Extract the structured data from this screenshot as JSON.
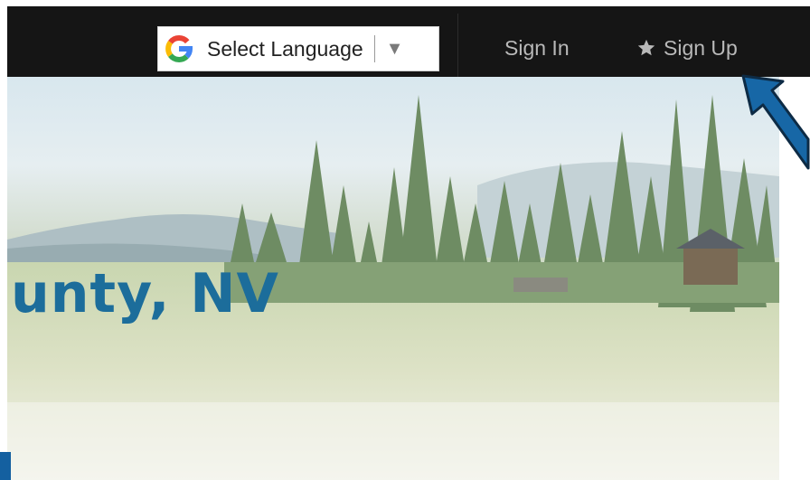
{
  "header": {
    "language_label": "Select Language",
    "language_caret": "▼",
    "sign_in": "Sign In",
    "sign_up": "Sign Up"
  },
  "hero": {
    "title": "unty, NV"
  },
  "icons": {
    "translate": "google-g-icon",
    "sign_up": "star-icon",
    "annotation": "arrow-icon"
  },
  "colors": {
    "topbar": "#151515",
    "nav_text": "#b9b9b9",
    "hero_title": "#1c6d9b",
    "arrow": "#1767a6"
  }
}
